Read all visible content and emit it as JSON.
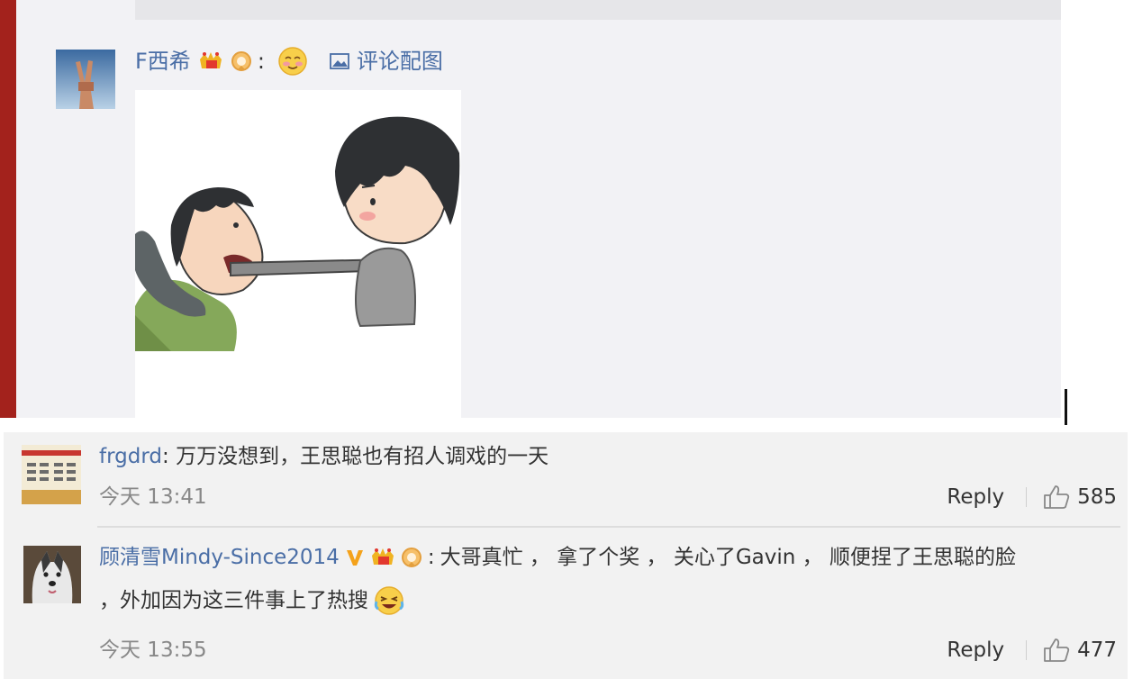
{
  "top_reply": {
    "username": "F西希",
    "colon": ":",
    "pic_link_label": "评论配图"
  },
  "comments": [
    {
      "username": "frgdrd",
      "separator": ":",
      "text": "万万没想到，王思聪也有招人调戏的一天",
      "time": "今天 13:41",
      "reply_label": "Reply",
      "likes": "585"
    },
    {
      "username": "顾清雪Mindy-Since2014",
      "separator": ":",
      "text_line1": "大哥真忙 ， 拿了个奖 ， 关心了Gavin ， 顺便捏了王思聪的脸",
      "text_line2": "，外加因为这三件事上了热搜",
      "time": "今天 13:55",
      "reply_label": "Reply",
      "likes": "477"
    }
  ],
  "icons": [
    "crown-badge-icon",
    "member-medal-icon",
    "emoji-face-icon",
    "image-icon",
    "verified-v-icon",
    "laughing-crying-emoji-icon",
    "thumbs-up-icon"
  ],
  "colors": {
    "link_blue": "#4a6ea6",
    "accent_red": "#a3221c",
    "verified_orange": "#f4a21b",
    "top_bg": "#f2f2f5",
    "bottom_bg": "#f2f2f2"
  }
}
